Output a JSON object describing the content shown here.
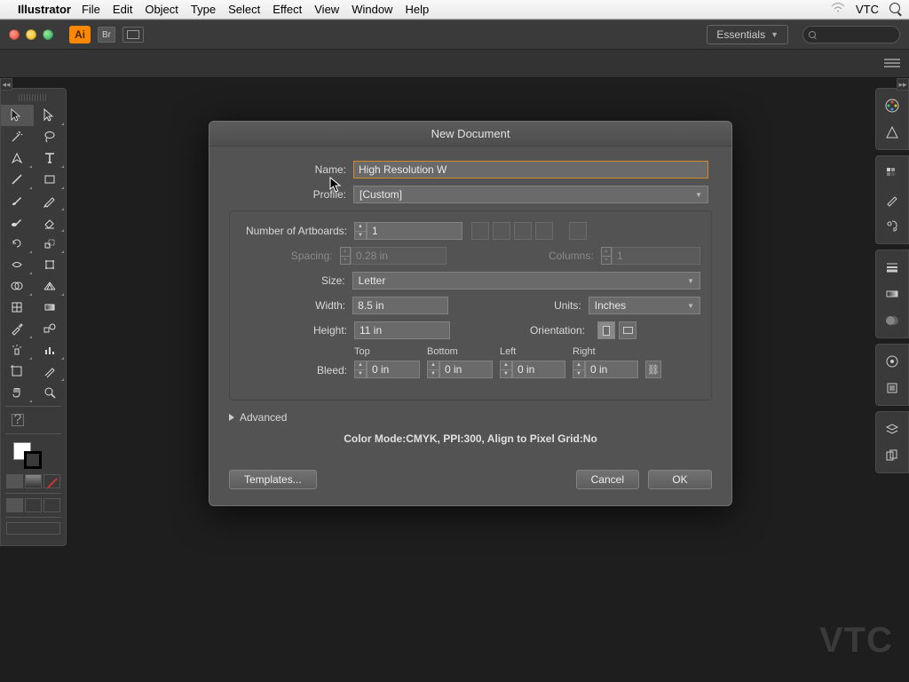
{
  "menubar": {
    "app": "Illustrator",
    "items": [
      "File",
      "Edit",
      "Object",
      "Type",
      "Select",
      "Effect",
      "View",
      "Window",
      "Help"
    ],
    "user": "VTC"
  },
  "appbar": {
    "ai_label": "Ai",
    "br_label": "Br",
    "workspace": "Essentials"
  },
  "dialog": {
    "title": "New Document",
    "labels": {
      "name": "Name:",
      "profile": "Profile:",
      "artboards": "Number of Artboards:",
      "spacing": "Spacing:",
      "columns": "Columns:",
      "size": "Size:",
      "width": "Width:",
      "units": "Units:",
      "height": "Height:",
      "orientation": "Orientation:",
      "bleed": "Bleed:",
      "top": "Top",
      "bottom": "Bottom",
      "left": "Left",
      "right": "Right",
      "advanced": "Advanced"
    },
    "values": {
      "name": "High Resolution W",
      "profile": "[Custom]",
      "artboards": "1",
      "spacing": "0.28 in",
      "columns": "1",
      "size": "Letter",
      "width": "8.5 in",
      "units": "Inches",
      "height": "11 in",
      "bleed_top": "0 in",
      "bleed_bottom": "0 in",
      "bleed_left": "0 in",
      "bleed_right": "0 in"
    },
    "mode_line": "Color Mode:CMYK, PPI:300, Align to Pixel Grid:No",
    "buttons": {
      "templates": "Templates...",
      "cancel": "Cancel",
      "ok": "OK"
    }
  },
  "watermark": "VTC"
}
